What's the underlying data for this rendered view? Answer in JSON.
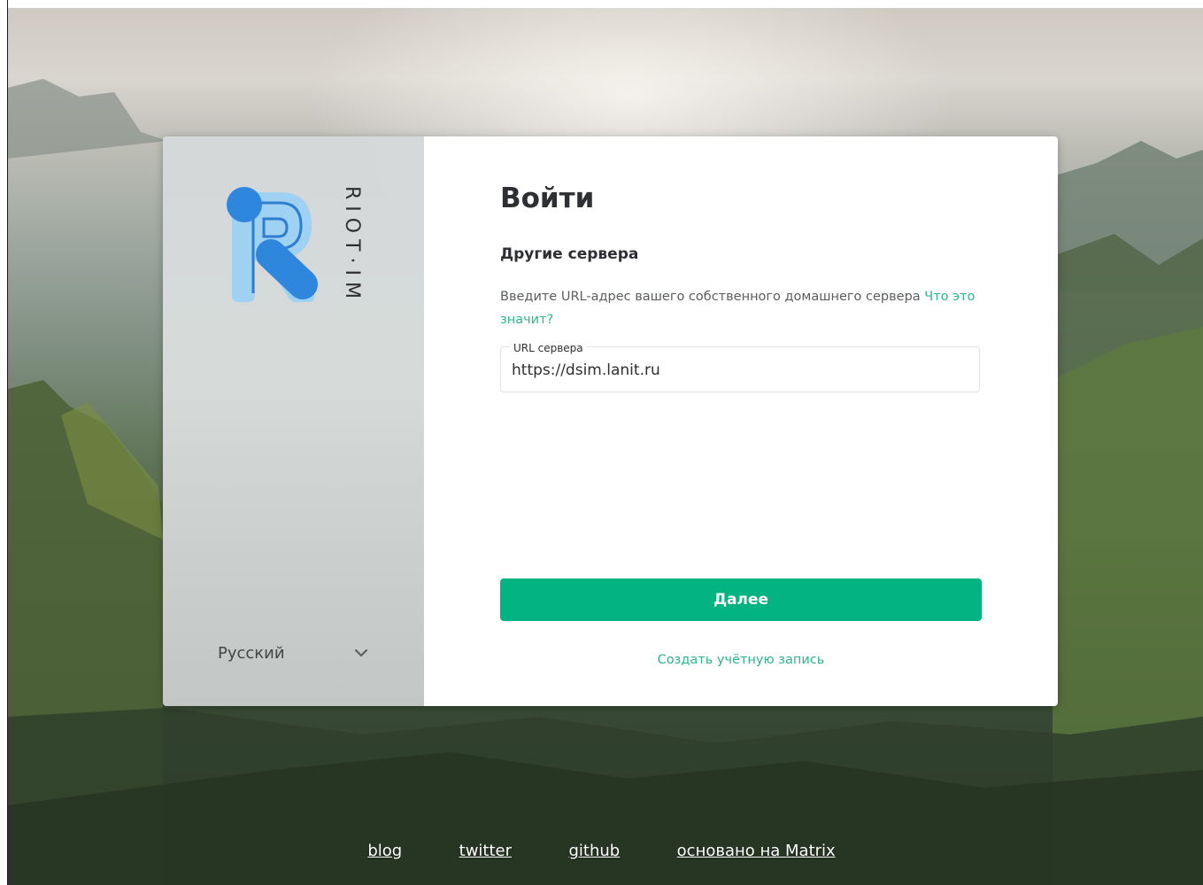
{
  "brand": {
    "name": "RIOT·IM",
    "logo_icon": "riot-logo-icon"
  },
  "language": {
    "selected": "Русский"
  },
  "login": {
    "title": "Войти",
    "subtitle": "Другие сервера",
    "description": "Введите URL-адрес вашего собственного домашнего сервера",
    "help_link": "Что это значит?",
    "server_url": {
      "label": "URL сервера",
      "value": "https://dsim.lanit.ru"
    },
    "next_button": "Далее",
    "create_account": "Создать учётную запись"
  },
  "footer": {
    "links": [
      "blog",
      "twitter",
      "github",
      "основано на Matrix"
    ]
  },
  "colors": {
    "accent": "#03b381",
    "link": "#2fb68c",
    "text": "#2e2f32"
  }
}
